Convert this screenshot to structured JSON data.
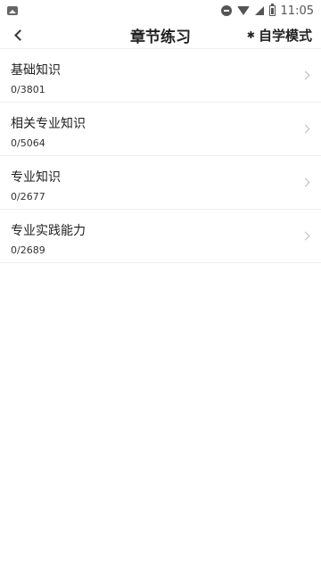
{
  "status_bar": {
    "time": "11:05",
    "icons": [
      "gallery-icon",
      "do-not-disturb-icon",
      "wifi-icon",
      "signal-icon",
      "battery-icon"
    ]
  },
  "header": {
    "title": "章节练习",
    "mode_label": "自学模式",
    "back_icon": "chevron-left-icon",
    "mode_icon": "gear-icon"
  },
  "chapters": [
    {
      "title": "基础知识",
      "progress": "0/3801"
    },
    {
      "title": "相关专业知识",
      "progress": "0/5064"
    },
    {
      "title": "专业知识",
      "progress": "0/2677"
    },
    {
      "title": "专业实践能力",
      "progress": "0/2689"
    }
  ]
}
